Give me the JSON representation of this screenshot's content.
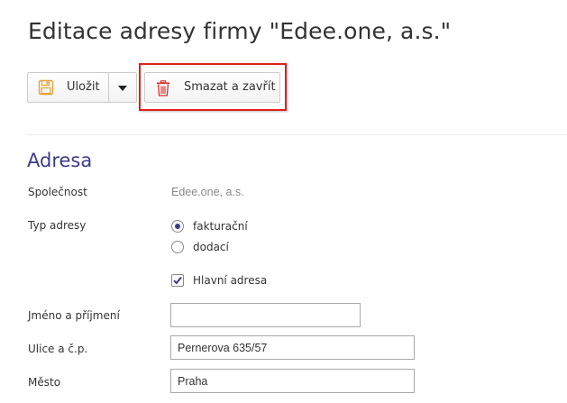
{
  "page": {
    "title": "Editace adresy firmy \"Edee.one, a.s.\""
  },
  "toolbar": {
    "save_label": "Uložit",
    "delete_label": "Smazat a zavřít"
  },
  "colors": {
    "accent": "#3c3c8c",
    "highlight": "#e0201a",
    "save_icon": "#e5a23b",
    "delete_icon": "#d9302b"
  },
  "section": {
    "title": "Adresa"
  },
  "form": {
    "company": {
      "label": "Společnost",
      "value": "Edee.one, a.s."
    },
    "address_type": {
      "label": "Typ adresy",
      "options": [
        {
          "label": "fakturační",
          "checked": true
        },
        {
          "label": "dodací",
          "checked": false
        }
      ]
    },
    "main_address": {
      "label": "Hlavní adresa",
      "checked": true
    },
    "full_name": {
      "label": "Jméno a příjmení",
      "value": ""
    },
    "street": {
      "label": "Ulice a č.p.",
      "value": "Pernerova 635/57"
    },
    "city": {
      "label": "Město",
      "value": "Praha"
    }
  }
}
